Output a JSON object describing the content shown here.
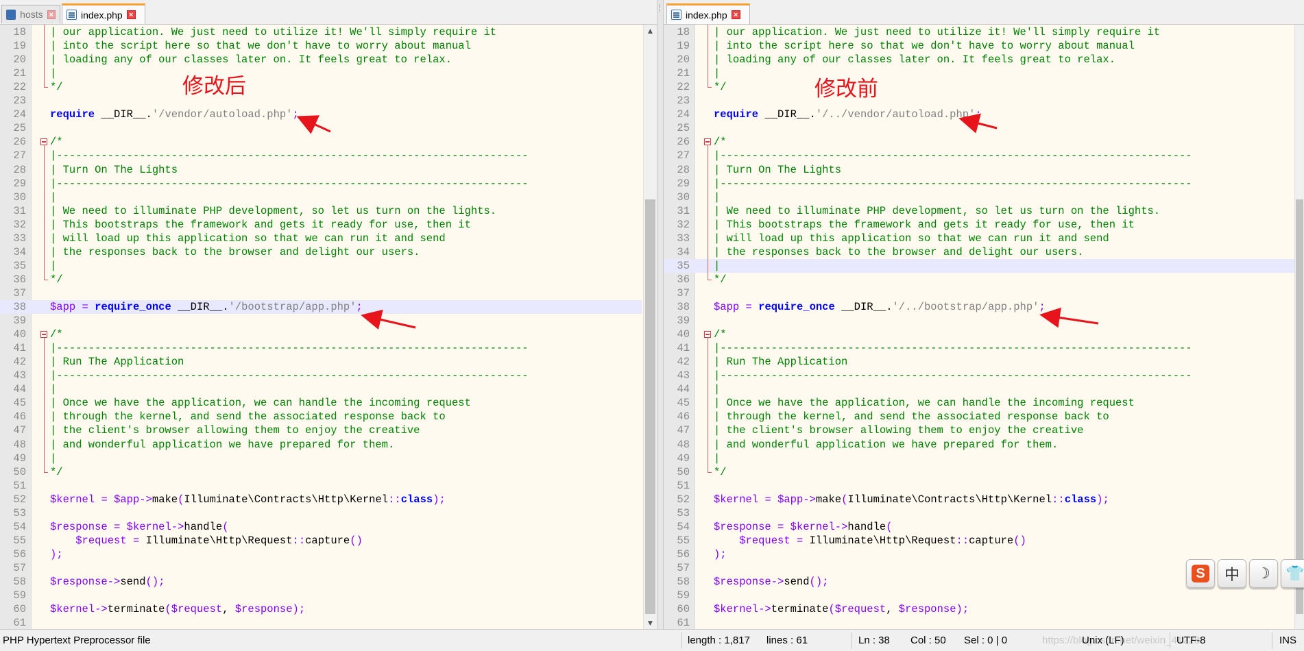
{
  "left": {
    "tabs": [
      {
        "label": "hosts",
        "active": false,
        "icon": "hosts-file-icon"
      },
      {
        "label": "index.php",
        "active": true,
        "icon": "php-file-icon"
      }
    ],
    "annotation": "修改后",
    "highlight_line": 38
  },
  "right": {
    "tabs": [
      {
        "label": "index.php",
        "active": true,
        "icon": "php-file-icon"
      }
    ],
    "annotation": "修改前",
    "highlight_line": 35
  },
  "code_left": [
    {
      "n": "18",
      "t": "| our application. We just need to utilize it! We'll simply require it"
    },
    {
      "n": "19",
      "t": "| into the script here so that we don't have to worry about manual"
    },
    {
      "n": "20",
      "t": "| loading any of our classes later on. It feels great to relax."
    },
    {
      "n": "21",
      "t": "|"
    },
    {
      "n": "22",
      "t": "*/"
    },
    {
      "n": "23",
      "t": ""
    },
    {
      "n": "24",
      "t": "require __DIR__.'/vendor/autoload.php';"
    },
    {
      "n": "25",
      "t": ""
    },
    {
      "n": "26",
      "t": "/*"
    },
    {
      "n": "27",
      "t": "|--------------------------------------------------------------------------"
    },
    {
      "n": "28",
      "t": "| Turn On The Lights"
    },
    {
      "n": "29",
      "t": "|--------------------------------------------------------------------------"
    },
    {
      "n": "30",
      "t": "|"
    },
    {
      "n": "31",
      "t": "| We need to illuminate PHP development, so let us turn on the lights."
    },
    {
      "n": "32",
      "t": "| This bootstraps the framework and gets it ready for use, then it"
    },
    {
      "n": "33",
      "t": "| will load up this application so that we can run it and send"
    },
    {
      "n": "34",
      "t": "| the responses back to the browser and delight our users."
    },
    {
      "n": "35",
      "t": "|"
    },
    {
      "n": "36",
      "t": "*/"
    },
    {
      "n": "37",
      "t": ""
    },
    {
      "n": "38",
      "t": "$app = require_once __DIR__.'/bootstrap/app.php';"
    },
    {
      "n": "39",
      "t": ""
    },
    {
      "n": "40",
      "t": "/*"
    },
    {
      "n": "41",
      "t": "|--------------------------------------------------------------------------"
    },
    {
      "n": "42",
      "t": "| Run The Application"
    },
    {
      "n": "43",
      "t": "|--------------------------------------------------------------------------"
    },
    {
      "n": "44",
      "t": "|"
    },
    {
      "n": "45",
      "t": "| Once we have the application, we can handle the incoming request"
    },
    {
      "n": "46",
      "t": "| through the kernel, and send the associated response back to"
    },
    {
      "n": "47",
      "t": "| the client's browser allowing them to enjoy the creative"
    },
    {
      "n": "48",
      "t": "| and wonderful application we have prepared for them."
    },
    {
      "n": "49",
      "t": "|"
    },
    {
      "n": "50",
      "t": "*/"
    },
    {
      "n": "51",
      "t": ""
    },
    {
      "n": "52",
      "t": "$kernel = $app->make(Illuminate\\Contracts\\Http\\Kernel::class);"
    },
    {
      "n": "53",
      "t": ""
    },
    {
      "n": "54",
      "t": "$response = $kernel->handle("
    },
    {
      "n": "55",
      "t": "    $request = Illuminate\\Http\\Request::capture()"
    },
    {
      "n": "56",
      "t": ");"
    },
    {
      "n": "57",
      "t": ""
    },
    {
      "n": "58",
      "t": "$response->send();"
    },
    {
      "n": "59",
      "t": ""
    },
    {
      "n": "60",
      "t": "$kernel->terminate($request, $response);"
    },
    {
      "n": "61",
      "t": ""
    }
  ],
  "right_diffs": {
    "24": "require __DIR__.'/../vendor/autoload.php';",
    "38": "$app = require_once __DIR__.'/../bootstrap/app.php';"
  },
  "status": {
    "file_type": "PHP Hypertext Preprocessor file",
    "length": "length : 1,817",
    "lines": "lines : 61",
    "ln": "Ln : 38",
    "col": "Col : 50",
    "sel": "Sel : 0 | 0",
    "watermark": "https://blog.csdn.net/weixin_41228",
    "eol": "Unix (LF)",
    "encoding": "UTF-8",
    "mode": "INS"
  },
  "ime_toolbar": [
    {
      "name": "sogou-logo-icon",
      "glyph": "S"
    },
    {
      "name": "chinese-mode-icon",
      "glyph": "中"
    },
    {
      "name": "moon-icon",
      "glyph": "☽"
    },
    {
      "name": "shirt-icon",
      "glyph": "👕"
    }
  ],
  "colors": {
    "comment": "#008000",
    "keyword": "#0000ff",
    "variable": "#8000ff",
    "string": "#808080",
    "annotation": "#e8141b",
    "tab_accent": "#f5a030"
  }
}
